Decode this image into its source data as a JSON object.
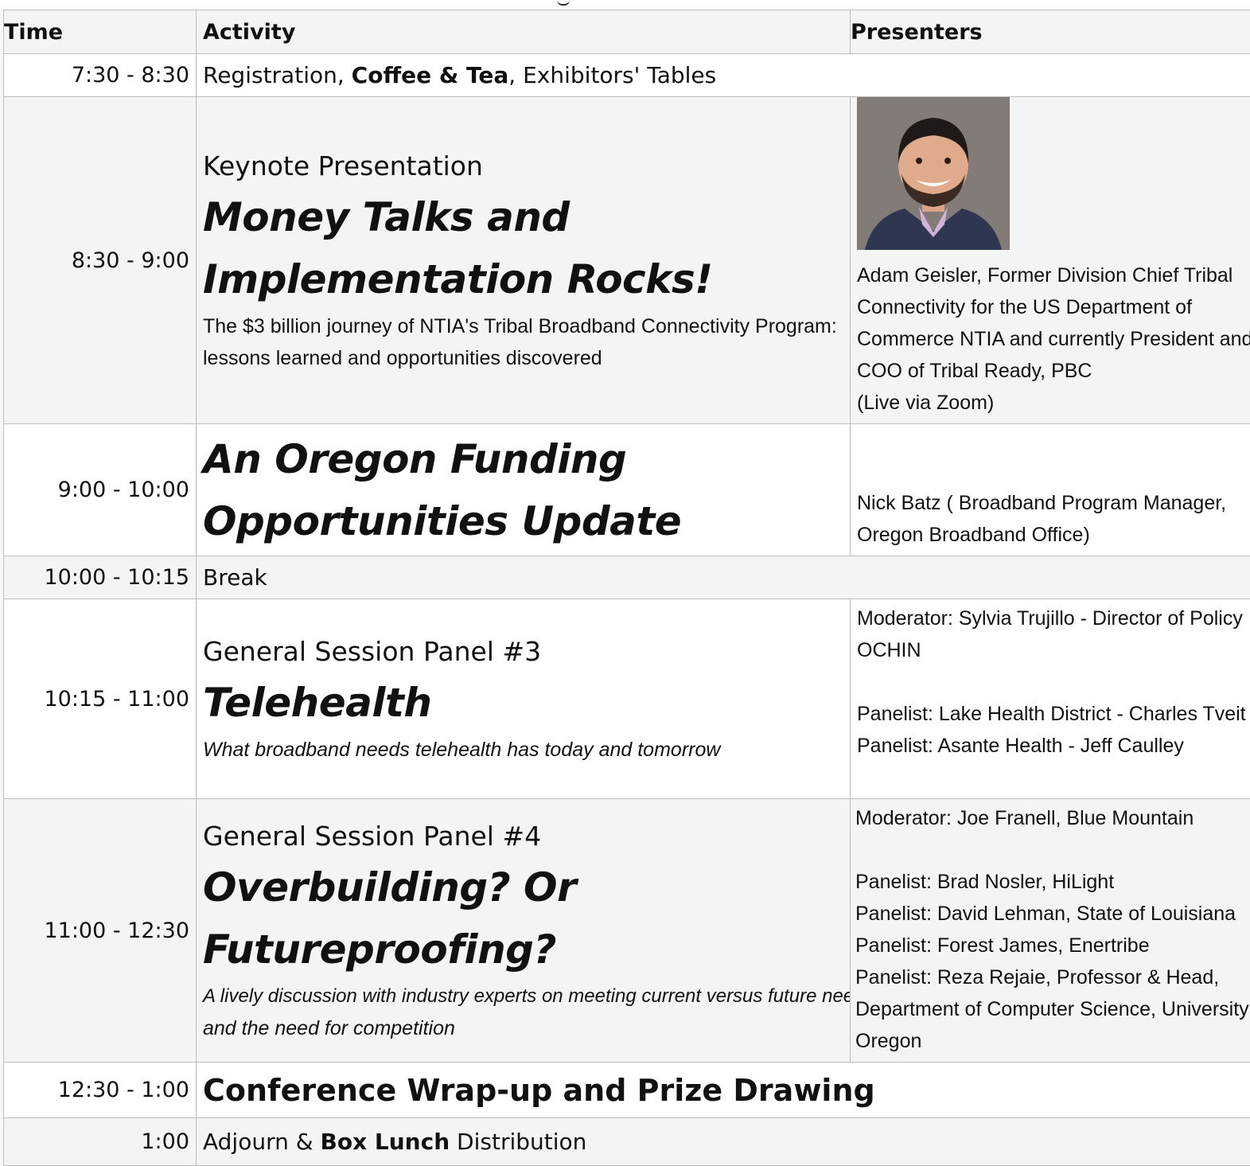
{
  "headers": {
    "time": "Time",
    "activity": "Activity",
    "presenters": "Presenters"
  },
  "rows": {
    "r1": {
      "time": "7:30 - 8:30",
      "before": "Registration, ",
      "bold": "Coffee & Tea",
      "after": ", Exhibitors' Tables"
    },
    "r2": {
      "time": "8:30 - 9:00",
      "kicker": "Keynote Presentation",
      "title_line1": "Money Talks and",
      "title_line2": "Implementation Rocks!",
      "sub_line1": "The $3 billion journey of NTIA's Tribal Broadband Connectivity Program:",
      "sub_line2": "lessons learned and opportunities discovered",
      "presenter": [
        "Adam Geisler, Former Division Chief Tribal",
        "Connectivity for the US Department of",
        "Commerce NTIA and currently President and",
        "COO of Tribal Ready, PBC",
        "(Live via Zoom)"
      ]
    },
    "r3": {
      "time": "9:00 - 10:00",
      "title_line1": "An Oregon Funding",
      "title_line2": "Opportunities Update",
      "presenter": [
        "Nick  Batz ( Broadband Program Manager,",
        "Oregon Broadband Office)"
      ]
    },
    "r4": {
      "time": "10:00 - 10:15",
      "activity": "Break"
    },
    "r5": {
      "time": "10:15 - 11:00",
      "kicker": "General Session Panel #3",
      "title": "Telehealth",
      "sub": "What broadband needs telehealth has today and tomorrow",
      "presenter": [
        "Moderator: Sylvia Trujillo - Director of Policy",
        "OCHIN",
        "",
        "Panelist: Lake Health District - Charles Tveit CEO",
        "Panelist: Asante Health - Jeff Caulley"
      ]
    },
    "r6": {
      "time": "11:00 - 12:30",
      "kicker": "General Session Panel #4",
      "title_line1": "Overbuilding? Or",
      "title_line2": "Futureproofing?",
      "sub_line1": "A lively discussion with industry experts on meeting current versus future needs",
      "sub_line2": "and the need for competition",
      "presenter": [
        "Moderator: Joe Franell, Blue Mountain",
        "",
        "Panelist: Brad Nosler, HiLight",
        "Panelist: David Lehman, State of Louisiana",
        "Panelist: Forest James, Enertribe",
        "Panelist: Reza Rejaie, Professor & Head,",
        "Department of Computer Science, University of",
        "Oregon"
      ]
    },
    "r7": {
      "time": "12:30 - 1:00",
      "title": "Conference Wrap-up and Prize Drawing"
    },
    "r8": {
      "time": "1:00",
      "before": "Adjourn & ",
      "bold": "Box Lunch",
      "after": " Distribution"
    }
  },
  "colors": {
    "header_bg": "#f4f4f4",
    "row_alt_bg": "#f4f4f4",
    "border": "#bdbdbd",
    "text": "#111111"
  }
}
